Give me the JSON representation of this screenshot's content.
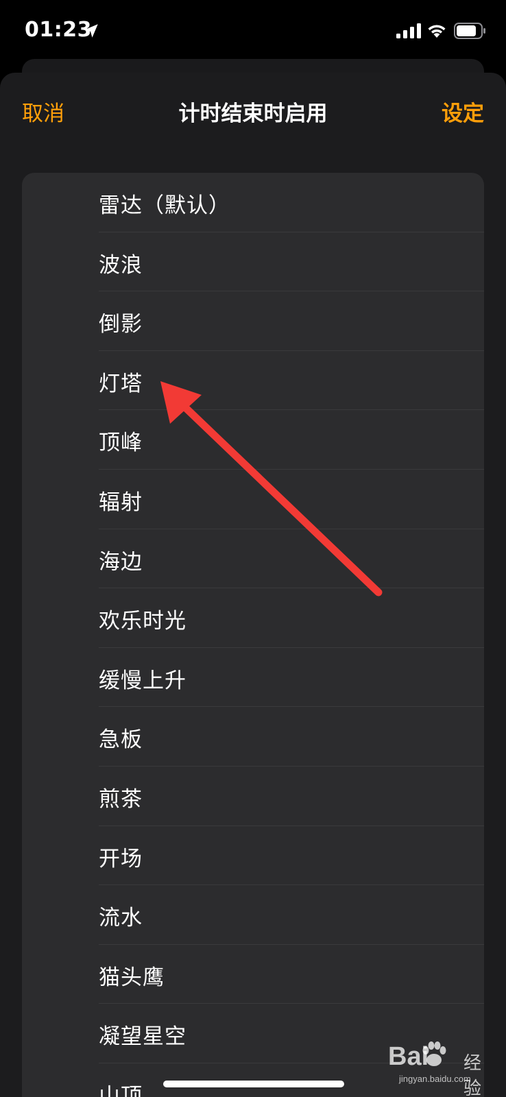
{
  "status_bar": {
    "time": "01:23",
    "icons": [
      "location-arrow-icon",
      "signal-icon",
      "wifi-icon",
      "battery-icon"
    ]
  },
  "nav": {
    "cancel_label": "取消",
    "title": "计时结束时启用",
    "set_label": "设定"
  },
  "sounds": [
    "雷达（默认）",
    "波浪",
    "倒影",
    "灯塔",
    "顶峰",
    "辐射",
    "海边",
    "欢乐时光",
    "缓慢上升",
    "急板",
    "煎茶",
    "开场",
    "流水",
    "猫头鹰",
    "凝望星空",
    "山顶"
  ],
  "watermark": {
    "brand": "Bai",
    "brand_suffix": "经验",
    "url": "jingyan.baidu.com"
  },
  "colors": {
    "accent": "#ff9f0a",
    "sheet_bg": "#1c1c1e",
    "card_bg": "#2c2c2e",
    "separator": "#3a3a3c",
    "arrow": "#f23a35"
  }
}
